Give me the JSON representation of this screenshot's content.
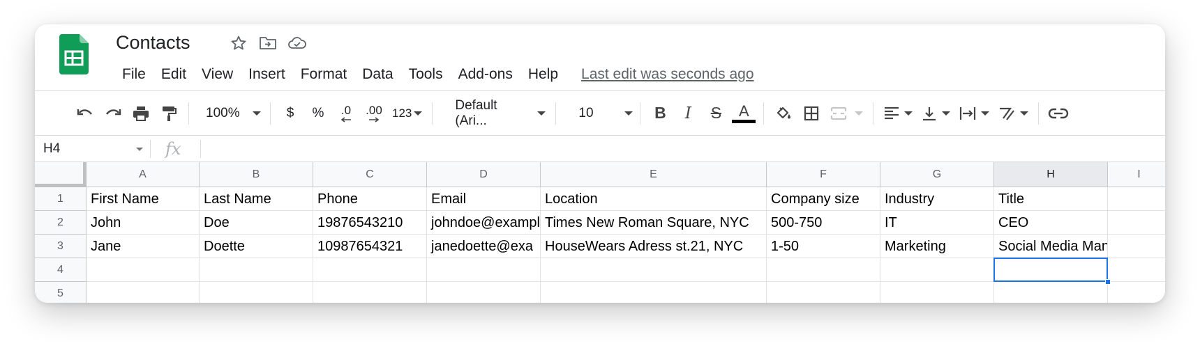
{
  "app": {
    "doc_title": "Contacts",
    "colors": {
      "brand_green": "#0F9D58",
      "selection_blue": "#1A73E8"
    },
    "title_icons": [
      "star-icon",
      "move-to-folder-icon",
      "cloud-saved-icon"
    ]
  },
  "menu": {
    "items": [
      "File",
      "Edit",
      "View",
      "Insert",
      "Format",
      "Data",
      "Tools",
      "Add-ons",
      "Help"
    ],
    "last_edit": "Last edit was seconds ago"
  },
  "toolbar": {
    "zoom": "100%",
    "currency": "$",
    "percent": "%",
    "decrease_decimals": ".0",
    "increase_decimals": ".00",
    "more_formats": "123",
    "font": "Default (Ari...",
    "font_size": "10",
    "bold": "B",
    "italic": "I",
    "strikethrough": "S",
    "text_color": "A"
  },
  "formula_bar": {
    "cell_ref": "H4",
    "fx": "fx",
    "content": ""
  },
  "sheet": {
    "columns": [
      "A",
      "B",
      "C",
      "D",
      "E",
      "F",
      "G",
      "H",
      "I"
    ],
    "row_numbers": [
      "1",
      "2",
      "3",
      "4",
      "5"
    ],
    "active_column": "H",
    "active_cell": "H4",
    "rows": [
      [
        "First Name",
        "Last Name",
        "Phone",
        "Email",
        "Location",
        "Company size",
        "Industry",
        "Title",
        ""
      ],
      [
        "John",
        "Doe",
        "19876543210",
        "johndoe@exampl",
        "Times New Roman Square, NYC",
        "500-750",
        "IT",
        "CEO",
        ""
      ],
      [
        "Jane",
        "Doette",
        "10987654321",
        "janedoette@exa",
        "HouseWears Adress st.21, NYC",
        "1-50",
        "Marketing",
        "Social Media Manager",
        ""
      ],
      [
        "",
        "",
        "",
        "",
        "",
        "",
        "",
        "",
        ""
      ],
      [
        "",
        "",
        "",
        "",
        "",
        "",
        "",
        "",
        ""
      ]
    ]
  }
}
